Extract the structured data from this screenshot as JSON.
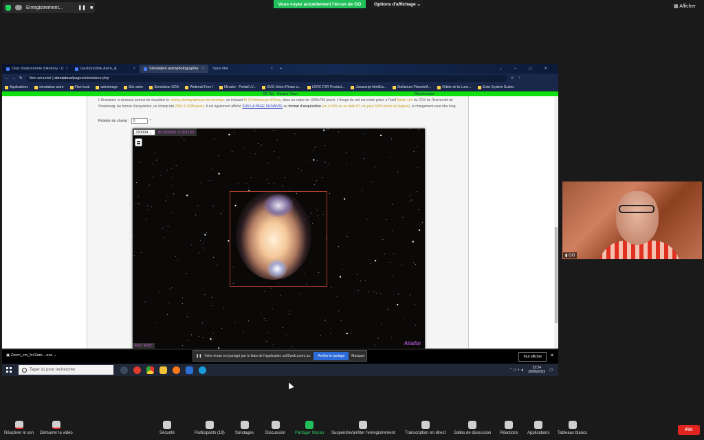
{
  "zoom_top": {
    "recording_label": "Enregistrement...",
    "banner": "Vous voyez actuellement l'écran de GO",
    "view_options": "Options d'affichage",
    "show_label": "Afficher"
  },
  "browser": {
    "tabs": [
      {
        "label": "Club d'astronomie d'Antony - C"
      },
      {
        "label": "Gestion/cible Astro_A"
      },
      {
        "label": "Simulation astrophotographie"
      },
      {
        "label": "Sans titre"
      }
    ],
    "security": "Non sécurisé",
    "url_host": "simulateur",
    "url_path": "/pages/simulateur.php",
    "bookmarks": [
      "Applications",
      "simulateur astro",
      "Plan local",
      "astroimage",
      "Site astro",
      "Simulateur GRA",
      "Webmail Free I",
      "Mirador - Portail LV...",
      "SVS: Moon Phase a...",
      "LROC P2R Product...",
      "Javascript html5/a...",
      "Stellarium Planets/A...",
      "Orbite de la Lune...",
      "Solar System Scales"
    ],
    "greenbar_center": "GO (là) · Gorgeu Orion",
    "greenbar_right": "Déconnexion",
    "intro_1": "L'illustration ci-dessous permet de visualiser le ",
    "intro_1_y": "champ photographique du montage",
    "intro_1b": ", en incluant ",
    "intro_1_y2": "M 42 Nébuleuse d'Orion",
    "intro_1c": ", dans un cadre de 1000x760 pixels. L'image du ciel est créée grâce à l'outil ",
    "intro_1_y3": "Aladin Lite",
    "intro_1d": " du CDS de l'Université de Strasbourg. Au format d'acquisition, ce champ fait ",
    "intro_1_y4": "2048 X 2048 pixels",
    "intro_1e": ". Il est également affiché ",
    "intro_link": "SUR LA PAGE SUIVANTE",
    "intro_1f": " au ",
    "intro_bold": "format d'acquisition",
    "intro_1_y5": " (en à 50% de sa taille d'1 cm pour 6000 pixels de largeur)",
    "intro_1g": ", le chargement peut être long.",
    "rotation_label": "Rotation du champ :",
    "rotation_value": "0",
    "rotation_unit": "°",
    "frame_select": "J2000d",
    "coords": "83.820000 -5.391100",
    "fov": "FoV: 4.00°",
    "aladin_logo": "Aladin"
  },
  "share_notice": {
    "text": "Votre écran est partagé par le biais de l'application us02web.zoom.us.",
    "stop": "Arrêter le partage",
    "hide": "Masquer"
  },
  "download": {
    "file": "Zoom_cm_fc42ark....exe",
    "show_all": "Tout afficher"
  },
  "taskbar": {
    "search": "Taper ici pour rechercher",
    "time": "22:24",
    "date": "20/05/2022"
  },
  "participant": {
    "name": "GO"
  },
  "toolbar": {
    "unmute": "Réactiver le son",
    "start_video": "Démarrer la vidéo",
    "security": "Sécurité",
    "participants": "Participants",
    "participants_count": "19",
    "polls": "Sondages",
    "chat": "Discussion",
    "share": "Partager l'écran",
    "record": "Suspendre/arrêter l'enregistrement",
    "captions": "Transcription en direct",
    "breakout": "Salles de discussion",
    "reactions": "Réactions",
    "apps": "Applications",
    "whiteboard": "Tableaux blancs",
    "end": "Fin"
  }
}
